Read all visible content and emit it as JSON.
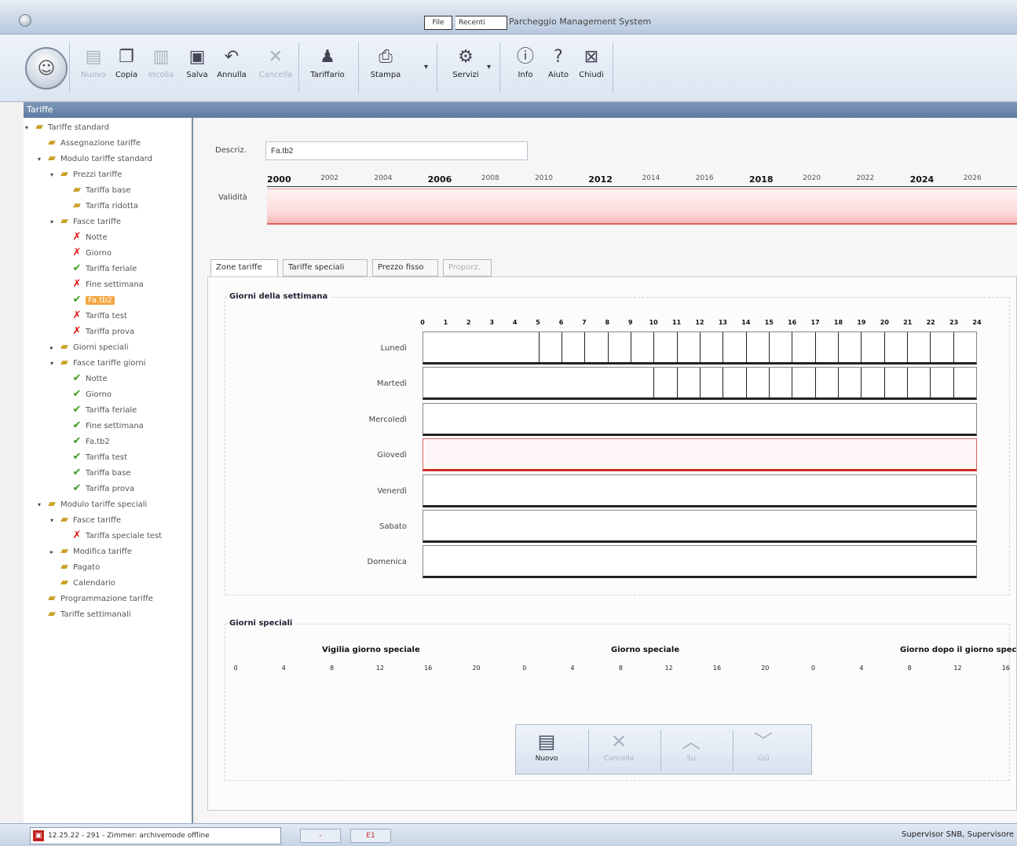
{
  "window": {
    "title": "Parcheggio Management System",
    "quick_file": "File",
    "quick_recent": "Recenti"
  },
  "ribbon": {
    "buttons": [
      {
        "label": "Nuovo",
        "icon": "new-doc-icon",
        "enabled": false
      },
      {
        "label": "Copia",
        "icon": "copy-icon",
        "enabled": true
      },
      {
        "label": "Incolla",
        "icon": "paste-icon",
        "enabled": false
      },
      {
        "label": "Salva",
        "icon": "save-icon",
        "enabled": true
      },
      {
        "label": "Annulla",
        "icon": "undo-icon",
        "enabled": true
      },
      {
        "label": "Cancella",
        "icon": "delete-icon",
        "enabled": false
      },
      {
        "label": "Tariffario",
        "icon": "tariff-icon",
        "enabled": true
      },
      {
        "label": "Stampa",
        "icon": "print-icon",
        "enabled": true
      },
      {
        "label": "Servizi",
        "icon": "services-icon",
        "enabled": true
      },
      {
        "label": "Info",
        "icon": "info-icon",
        "enabled": true
      },
      {
        "label": "Aiuto",
        "icon": "help-icon",
        "enabled": true
      },
      {
        "label": "Chiudi",
        "icon": "close-icon",
        "enabled": true
      }
    ]
  },
  "panel": {
    "header": "Tariffe"
  },
  "tree": [
    {
      "label": "Tariffe standard",
      "icon": "folder",
      "level": 0,
      "expand": "-"
    },
    {
      "label": "Assegnazione tariffe",
      "icon": "folder",
      "level": 1,
      "expand": ""
    },
    {
      "label": "Modulo tariffe standard",
      "icon": "folder",
      "level": 1,
      "expand": "-"
    },
    {
      "label": "Prezzi tariffe",
      "icon": "folder",
      "level": 2,
      "expand": "-"
    },
    {
      "label": "Tariffa base",
      "icon": "folder",
      "level": 3,
      "expand": ""
    },
    {
      "label": "Tariffa ridotta",
      "icon": "folder",
      "level": 3,
      "expand": ""
    },
    {
      "label": "Fasce tariffe",
      "icon": "folder",
      "level": 2,
      "expand": "-"
    },
    {
      "label": "Notte",
      "icon": "x",
      "level": 3,
      "expand": ""
    },
    {
      "label": "Giorno",
      "icon": "x",
      "level": 3,
      "expand": ""
    },
    {
      "label": "Tariffa feriale",
      "icon": "ok",
      "level": 3,
      "expand": ""
    },
    {
      "label": "Fine settimana",
      "icon": "x",
      "level": 3,
      "expand": ""
    },
    {
      "label": "Fa.tb2",
      "icon": "ok",
      "level": 3,
      "expand": "",
      "selected": true
    },
    {
      "label": "Tariffa test",
      "icon": "x",
      "level": 3,
      "expand": ""
    },
    {
      "label": "Tariffa prova",
      "icon": "x",
      "level": 3,
      "expand": ""
    },
    {
      "label": "Giorni speciali",
      "icon": "folder",
      "level": 2,
      "expand": "+"
    },
    {
      "label": "Fasce tariffe giorni",
      "icon": "folder",
      "level": 2,
      "expand": "-"
    },
    {
      "label": "Notte",
      "icon": "ok",
      "level": 3,
      "expand": ""
    },
    {
      "label": "Giorno",
      "icon": "ok",
      "level": 3,
      "expand": ""
    },
    {
      "label": "Tariffa feriale",
      "icon": "ok",
      "level": 3,
      "expand": ""
    },
    {
      "label": "Fine settimana",
      "icon": "ok",
      "level": 3,
      "expand": ""
    },
    {
      "label": "Fa.tb2",
      "icon": "ok",
      "level": 3,
      "expand": ""
    },
    {
      "label": "Tariffa test",
      "icon": "ok",
      "level": 3,
      "expand": ""
    },
    {
      "label": "Tariffa base",
      "icon": "ok",
      "level": 3,
      "expand": ""
    },
    {
      "label": "Tariffa prova",
      "icon": "ok",
      "level": 3,
      "expand": ""
    },
    {
      "label": "Modulo tariffe speciali",
      "icon": "folder",
      "level": 1,
      "expand": "-"
    },
    {
      "label": "Fasce tariffe",
      "icon": "folder",
      "level": 2,
      "expand": "-"
    },
    {
      "label": "Tariffa speciale test",
      "icon": "x",
      "level": 3,
      "expand": ""
    },
    {
      "label": "Modifica tariffe",
      "icon": "folder",
      "level": 2,
      "expand": "+"
    },
    {
      "label": "Pagato",
      "icon": "folder",
      "level": 2,
      "expand": ""
    },
    {
      "label": "Calendario",
      "icon": "folder",
      "level": 2,
      "expand": ""
    },
    {
      "label": "Programmazione tariffe",
      "icon": "folder",
      "level": 1,
      "expand": ""
    },
    {
      "label": "Tariffe settimanali",
      "icon": "folder",
      "level": 1,
      "expand": ""
    }
  ],
  "form": {
    "description_label": "Descriz.",
    "description_value": "Fa.tb2",
    "validity_label": "Validità",
    "years": [
      {
        "label": "2000",
        "major": true
      },
      {
        "label": "2002",
        "major": false
      },
      {
        "label": "2004",
        "major": false
      },
      {
        "label": "2006",
        "major": true
      },
      {
        "label": "2008",
        "major": false
      },
      {
        "label": "2010",
        "major": false
      },
      {
        "label": "2012",
        "major": true
      },
      {
        "label": "2014",
        "major": false
      },
      {
        "label": "2016",
        "major": false
      },
      {
        "label": "2018",
        "major": true
      },
      {
        "label": "2020",
        "major": false
      },
      {
        "label": "2022",
        "major": false
      },
      {
        "label": "2024",
        "major": true
      },
      {
        "label": "2026",
        "major": false
      }
    ]
  },
  "tabs": [
    {
      "label": "Zone tariffe",
      "active": true,
      "enabled": true
    },
    {
      "label": "Tariffe speciali",
      "active": false,
      "enabled": true
    },
    {
      "label": "Prezzo fisso",
      "active": false,
      "enabled": true
    },
    {
      "label": "Proporz.",
      "active": false,
      "enabled": false
    }
  ],
  "week": {
    "title": "Giorni della settimana",
    "hours": [
      "0",
      "1",
      "2",
      "3",
      "4",
      "5",
      "6",
      "7",
      "8",
      "9",
      "10",
      "11",
      "12",
      "13",
      "14",
      "15",
      "16",
      "17",
      "18",
      "19",
      "20",
      "21",
      "22",
      "23",
      "24"
    ],
    "days": [
      {
        "label": "Lunedì",
        "ticks_from_hour": 5,
        "highlight": false
      },
      {
        "label": "Martedì",
        "ticks_from_hour": 10,
        "highlight": false
      },
      {
        "label": "Mercoledì",
        "ticks_from_hour": null,
        "highlight": false
      },
      {
        "label": "Giovedì",
        "ticks_from_hour": null,
        "highlight": true
      },
      {
        "label": "Venerdì",
        "ticks_from_hour": null,
        "highlight": false
      },
      {
        "label": "Sabato",
        "ticks_from_hour": null,
        "highlight": false
      },
      {
        "label": "Domenica",
        "ticks_from_hour": null,
        "highlight": false
      }
    ]
  },
  "special": {
    "title": "Giorni speciali",
    "headings": [
      "Vigilia giorno speciale",
      "Giorno speciale",
      "Giorno dopo il giorno speciale"
    ],
    "scale": [
      "0",
      "4",
      "8",
      "12",
      "16",
      "20",
      "0",
      "4",
      "8",
      "12",
      "16",
      "20",
      "0",
      "4",
      "8",
      "12",
      "16"
    ]
  },
  "bottom_toolbar": [
    {
      "label": "Nuovo",
      "icon": "new-doc-icon",
      "enabled": true
    },
    {
      "label": "Cancella",
      "icon": "delete-icon",
      "enabled": false
    },
    {
      "label": "Su",
      "icon": "arrow-up-icon",
      "enabled": false
    },
    {
      "label": "Giù",
      "icon": "arrow-down-icon",
      "enabled": false
    }
  ],
  "status": {
    "task": "12.25.22 - 291 - Zimmer: archivemode offline",
    "mini1": "-",
    "mini2": "E1",
    "user": "Supervisor SNB, Supervisore"
  },
  "colors": {
    "validity_fill": "#f4b6b6",
    "highlight_row": "#cc2c2c",
    "selected_node": "#f2a640",
    "error_icon": "#e01010",
    "ok_icon": "#3c9a1e"
  }
}
